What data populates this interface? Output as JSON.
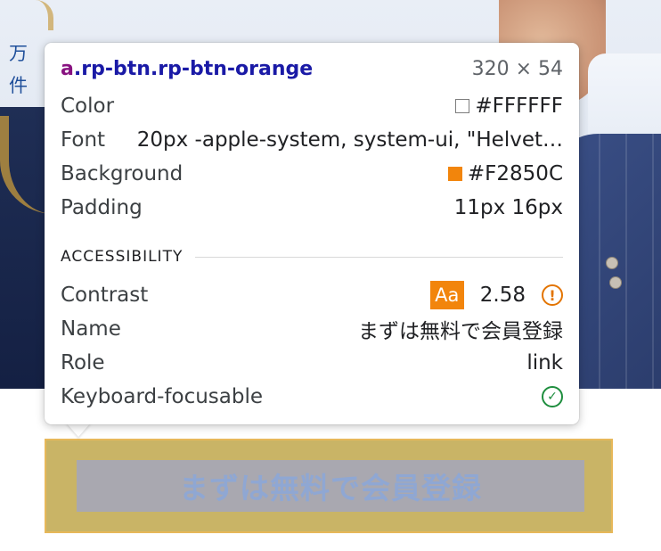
{
  "page": {
    "side_text": [
      "万",
      "件"
    ]
  },
  "tooltip": {
    "selector_tag": "a",
    "selector_class": ".rp-btn.rp-btn-orange",
    "dimensions": "320 × 54",
    "properties": [
      {
        "label": "Color",
        "value": "#FFFFFF",
        "swatch": "#FFFFFF"
      },
      {
        "label": "Font",
        "value": "20px -apple-system, system-ui, \"Helvet…"
      },
      {
        "label": "Background",
        "value": "#F2850C",
        "swatch": "#F2850C"
      },
      {
        "label": "Padding",
        "value": "11px 16px"
      }
    ],
    "accessibility": {
      "title": "ACCESSIBILITY",
      "contrast_label": "Contrast",
      "contrast_badge": "Aa",
      "contrast_value": "2.58",
      "contrast_warning_icon": "warning-circle-icon",
      "name_label": "Name",
      "name_value": "まずは無料で会員登録",
      "role_label": "Role",
      "role_value": "link",
      "keyboard_label": "Keyboard-focusable",
      "keyboard_icon": "check-circle-icon"
    }
  },
  "button": {
    "label": "まずは無料で会員登録"
  },
  "colors": {
    "accent_orange": "#F2850C",
    "highlight_margin": "#c9b466",
    "highlight_content": "#a9a8b0"
  }
}
